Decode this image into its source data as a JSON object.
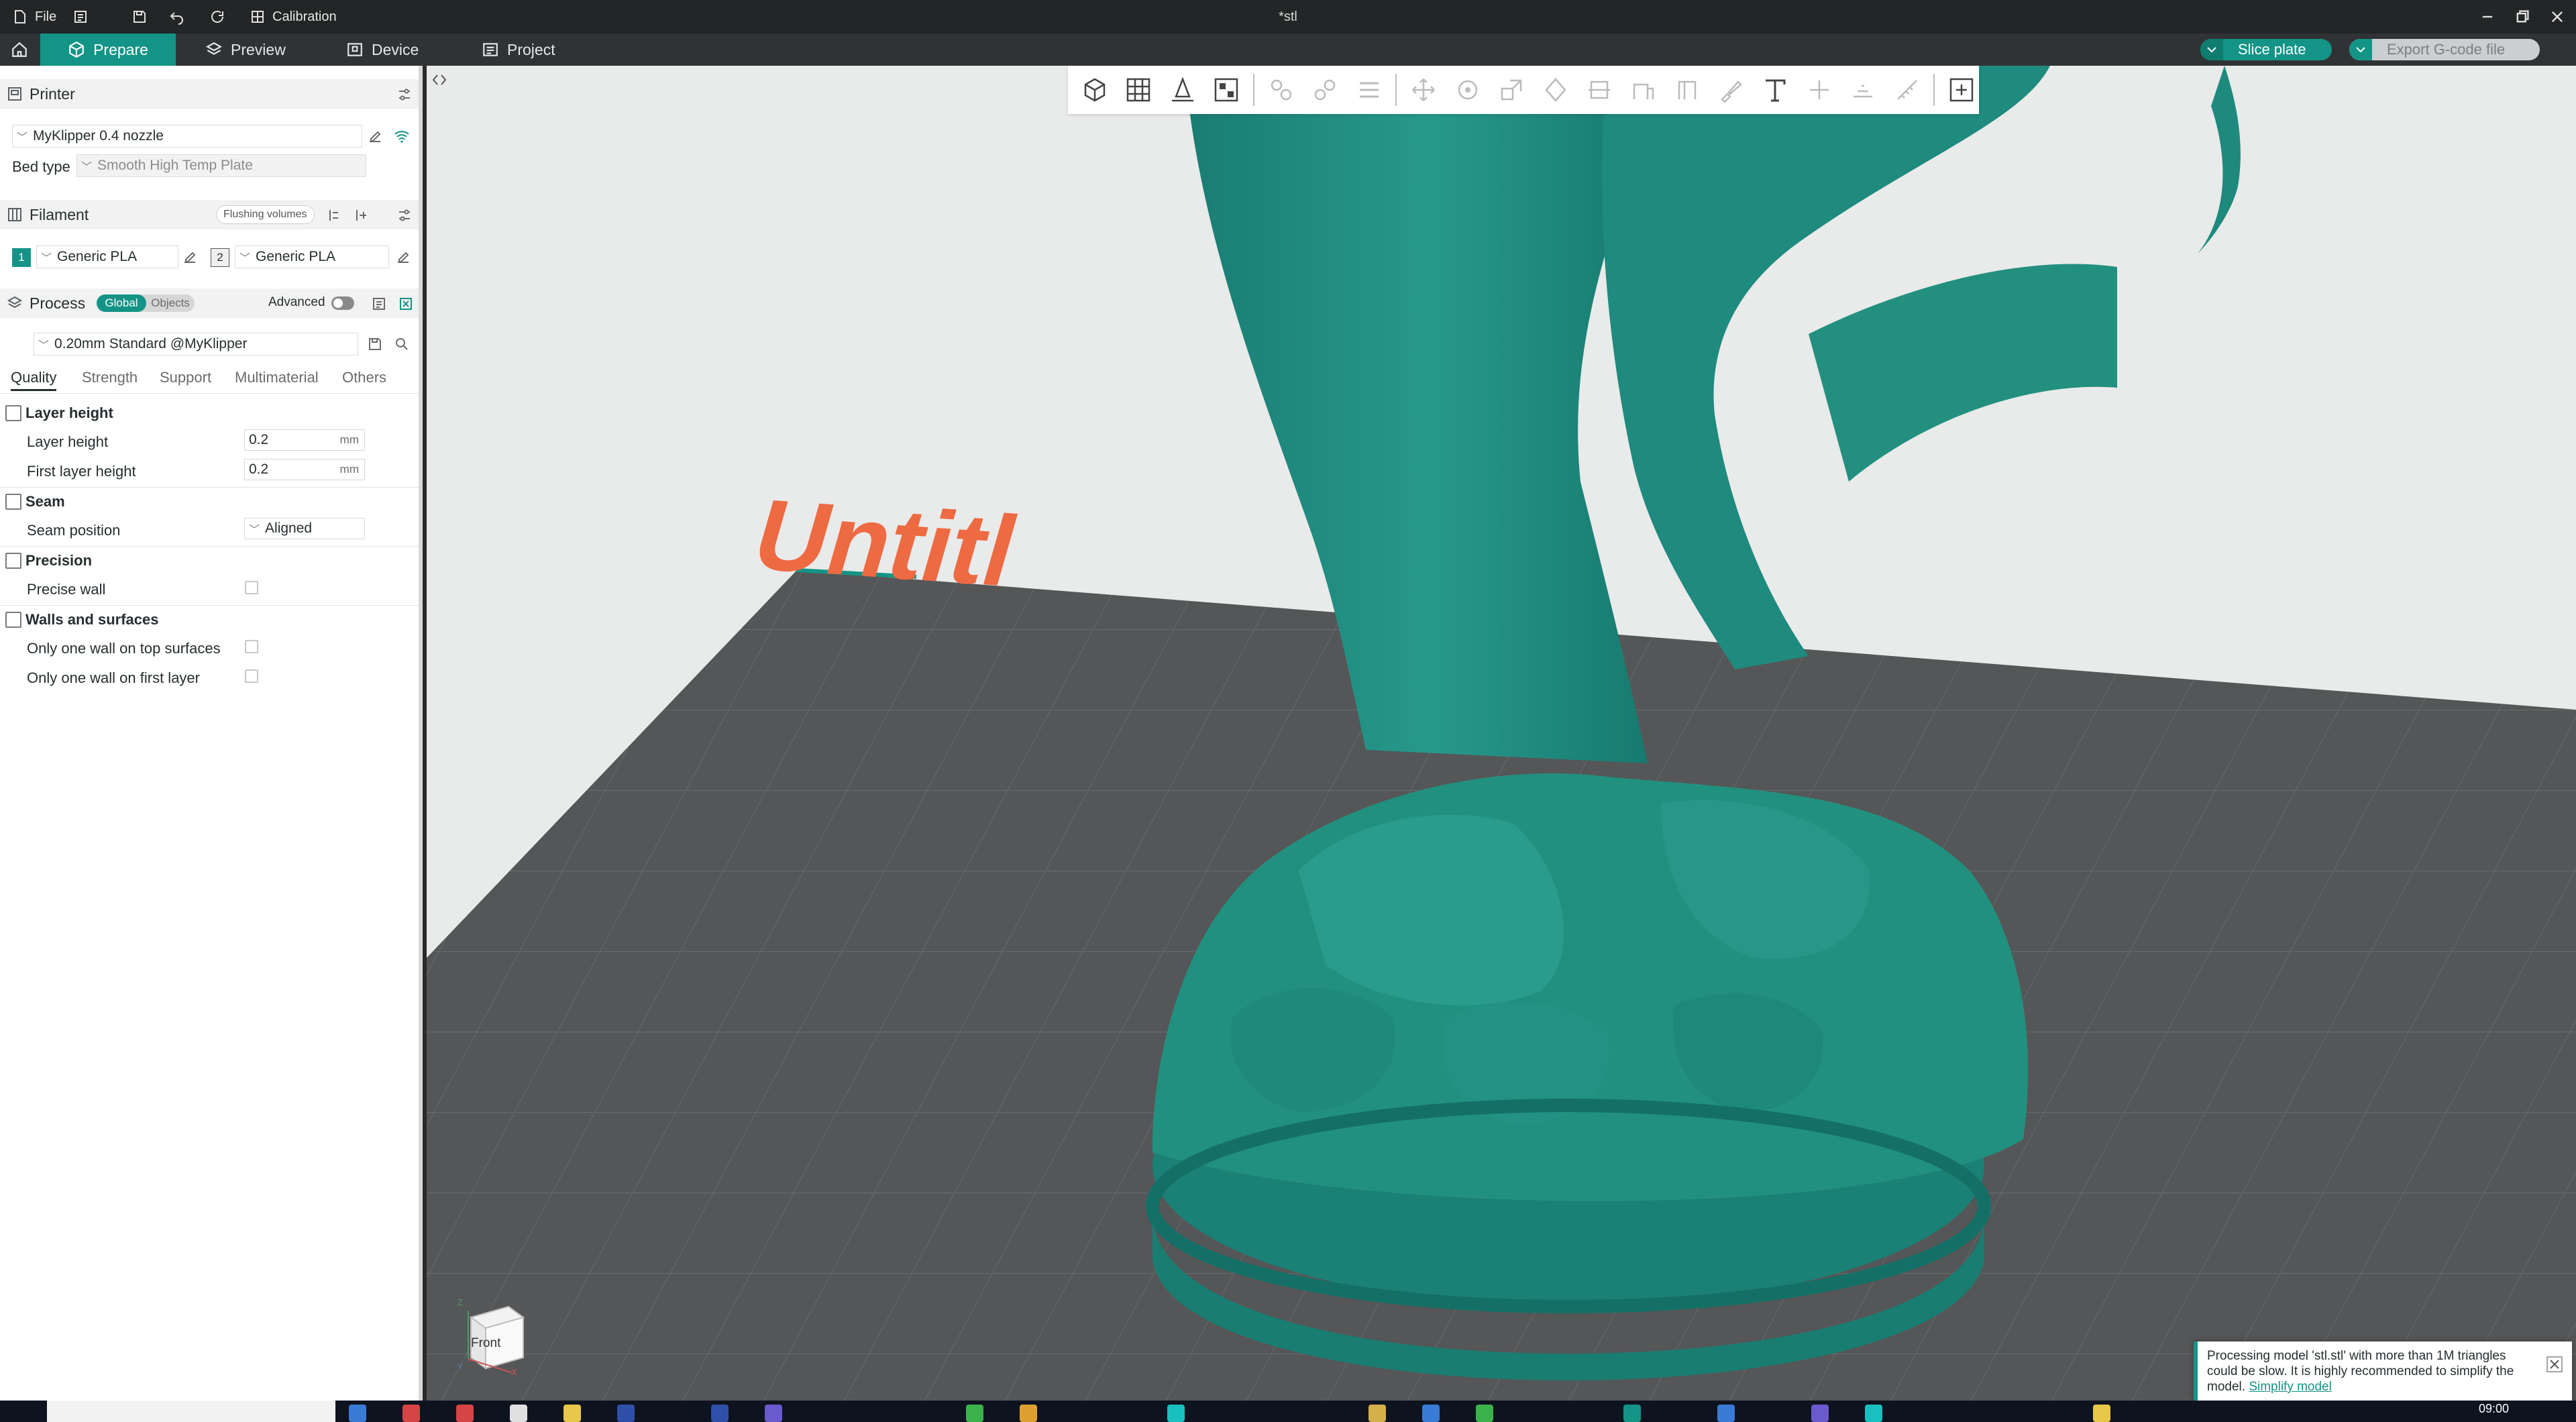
{
  "titlebar": {
    "file_menu": "File",
    "calibration": "Calibration",
    "doc_title": "*stl"
  },
  "nav": {
    "tabs": [
      {
        "label": "Prepare",
        "icon": "cube-icon",
        "active": true
      },
      {
        "label": "Preview",
        "icon": "layers-icon",
        "active": false
      },
      {
        "label": "Device",
        "icon": "device-icon",
        "active": false
      },
      {
        "label": "Project",
        "icon": "project-icon",
        "active": false
      }
    ],
    "slice_label": "Slice plate",
    "export_label": "Export G-code file"
  },
  "printer": {
    "section_title": "Printer",
    "printer_name": "MyKlipper 0.4 nozzle",
    "bed_type_label": "Bed type",
    "bed_type_value": "Smooth High Temp Plate"
  },
  "filament": {
    "section_title": "Filament",
    "flushing_label": "Flushing volumes",
    "slots": [
      {
        "index": "1",
        "name": "Generic PLA"
      },
      {
        "index": "2",
        "name": "Generic PLA"
      }
    ]
  },
  "process": {
    "section_title": "Process",
    "global_label": "Global",
    "objects_label": "Objects",
    "advanced_label": "Advanced",
    "preset": "0.20mm Standard @MyKlipper",
    "tabs": [
      "Quality",
      "Strength",
      "Support",
      "Multimaterial",
      "Others"
    ],
    "groups": {
      "layer_height": {
        "title": "Layer height",
        "layer_height_label": "Layer height",
        "layer_height_value": "0.2",
        "first_layer_label": "First layer height",
        "first_layer_value": "0.2",
        "unit": "mm"
      },
      "seam": {
        "title": "Seam",
        "position_label": "Seam position",
        "position_value": "Aligned"
      },
      "precision": {
        "title": "Precision",
        "precise_wall_label": "Precise wall"
      },
      "walls": {
        "title": "Walls and surfaces",
        "one_wall_top_label": "Only one wall on top surfaces",
        "one_wall_first_label": "Only one wall on first layer"
      }
    }
  },
  "viewport": {
    "plate_text": "Untitl",
    "view_cube_label": "Front",
    "axis_labels": [
      "Z",
      "Y",
      "X"
    ]
  },
  "notification": {
    "message": "Processing model 'stl.stl' with more than 1M triangles could be slow. It is highly recommended to simplify the model.",
    "link": "Simplify model"
  },
  "taskbar": {
    "clock": "09:00"
  },
  "colors": {
    "accent": "#139486",
    "model": "#1e8a7e",
    "bed": "#555657",
    "plate_text": "#ee6a42"
  }
}
